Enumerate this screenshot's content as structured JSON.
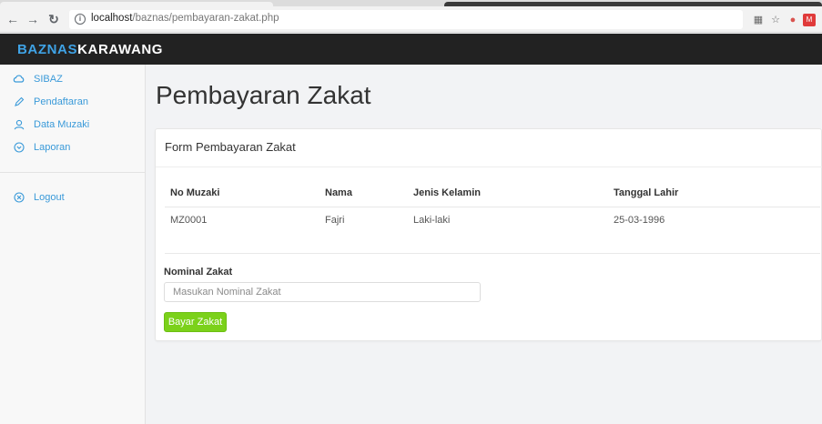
{
  "browser": {
    "url_host": "localhost",
    "url_path": "/baznas/pembayaran-zakat.php"
  },
  "navbar": {
    "brand_part1": "BAZNAS",
    "brand_part2": "KARAWANG"
  },
  "sidebar": {
    "items": [
      {
        "label": "SIBAZ",
        "icon": "cloud-icon"
      },
      {
        "label": "Pendaftaran",
        "icon": "pencil-icon"
      },
      {
        "label": "Data Muzaki",
        "icon": "user-icon"
      },
      {
        "label": "Laporan",
        "icon": "chevron-circle-icon"
      }
    ],
    "logout": {
      "label": "Logout",
      "icon": "close-circle-icon"
    }
  },
  "main": {
    "page_title": "Pembayaran Zakat",
    "panel_title": "Form Pembayaran Zakat",
    "table": {
      "headers": [
        "No Muzaki",
        "Nama",
        "Jenis Kelamin",
        "Tanggal Lahir"
      ],
      "rows": [
        [
          "MZ0001",
          "Fajri",
          "Laki-laki",
          "25-03-1996"
        ]
      ]
    },
    "form": {
      "label": "Nominal Zakat",
      "placeholder": "Masukan Nominal Zakat",
      "value": "",
      "submit_label": "Bayar Zakat"
    }
  },
  "colors": {
    "brand_accent": "#3fa3e6",
    "navbar_bg": "#222222",
    "sidebar_link": "#3a9ad9",
    "submit_button": "#7bd11a"
  }
}
